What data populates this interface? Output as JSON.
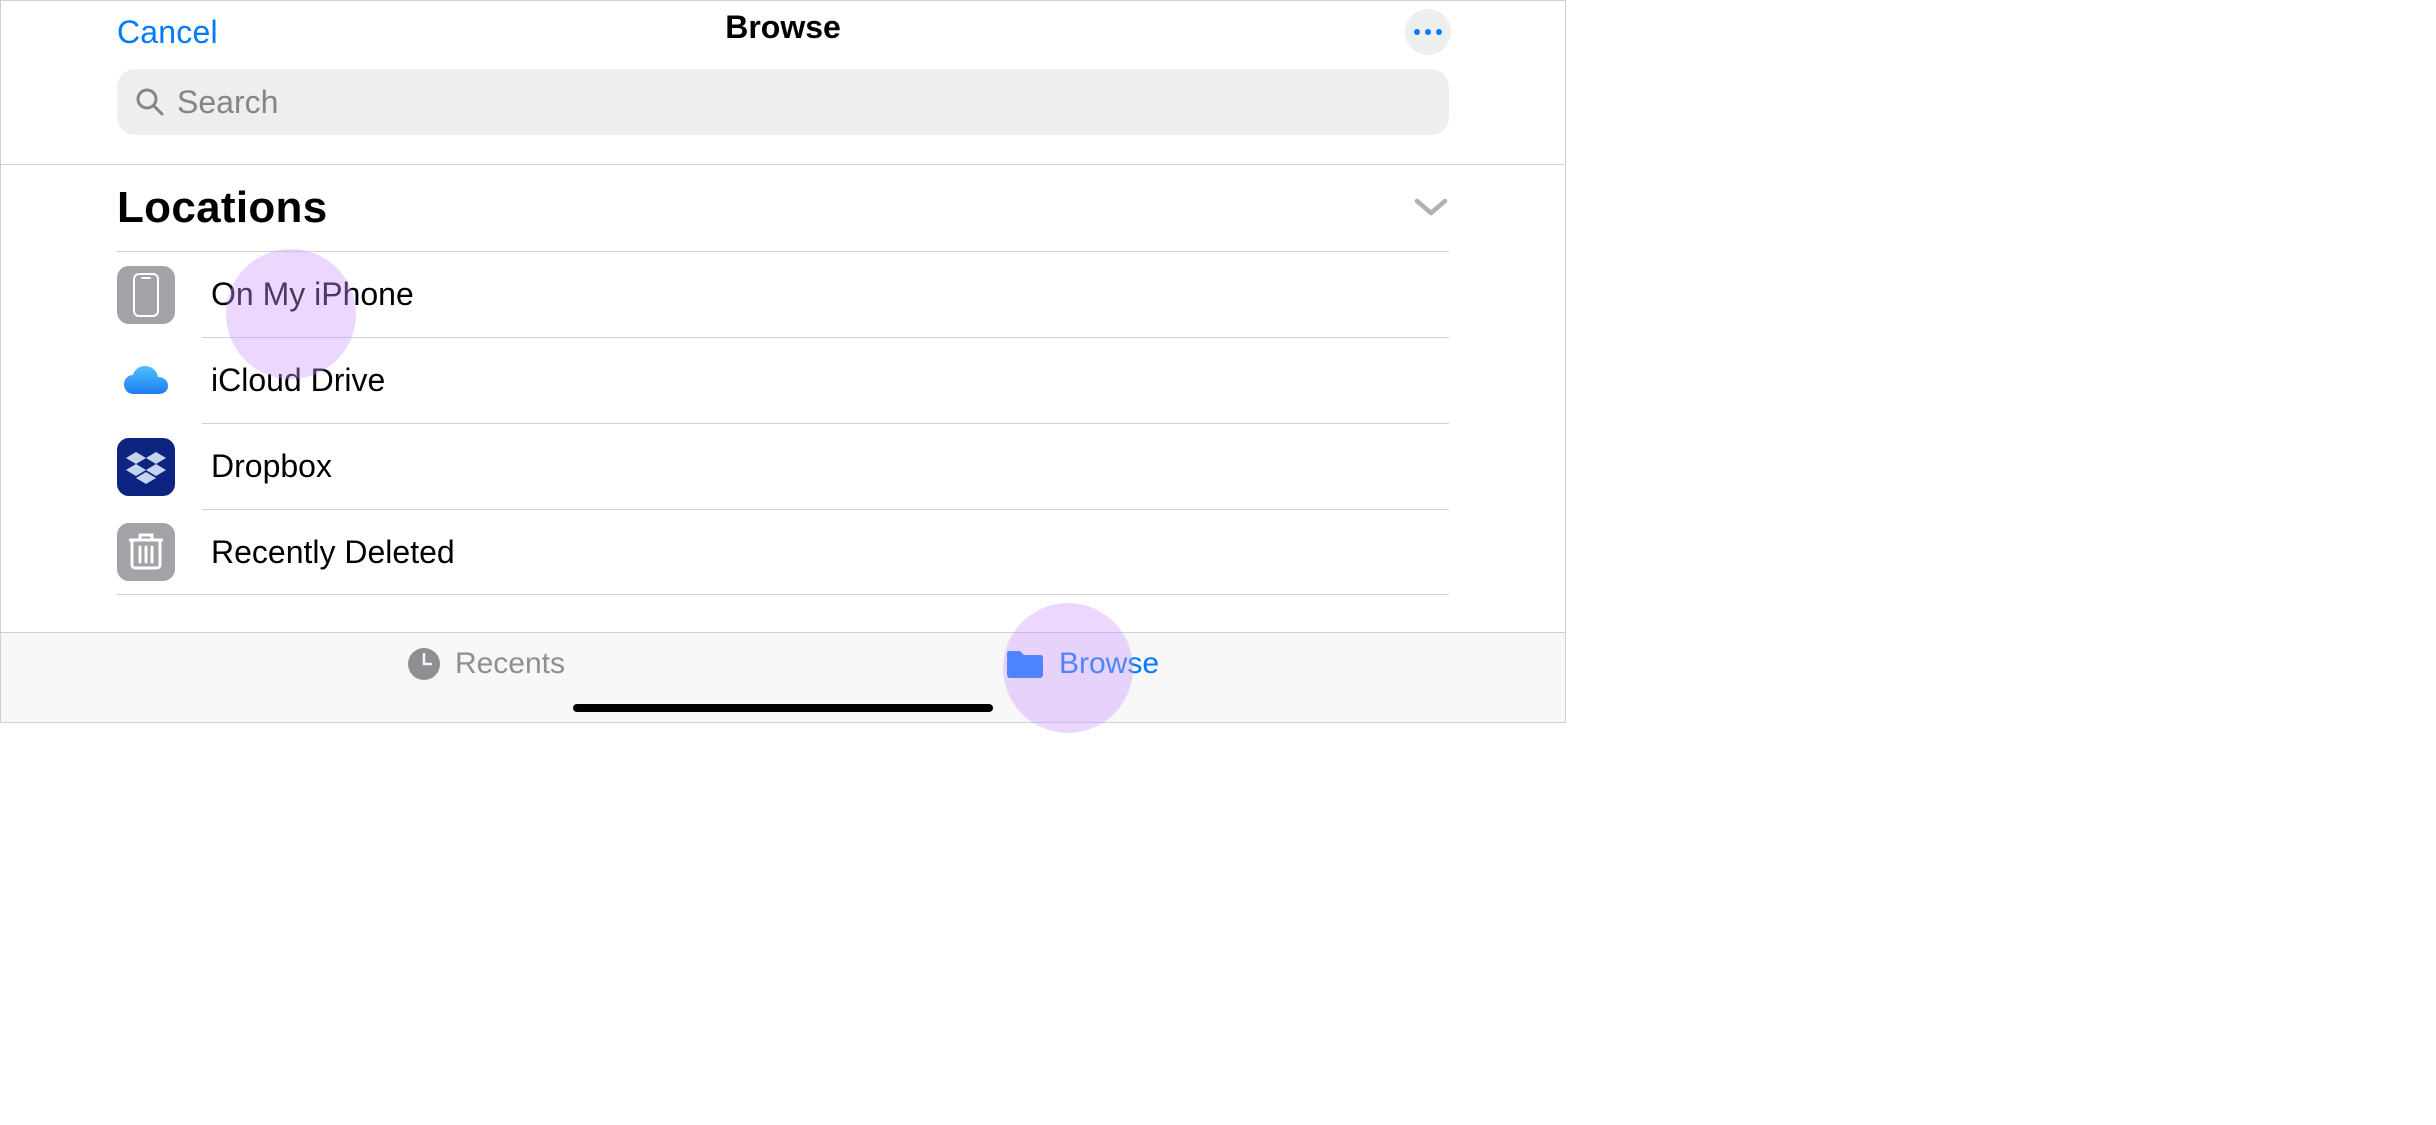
{
  "header": {
    "cancel_label": "Cancel",
    "title": "Browse"
  },
  "search": {
    "placeholder": "Search"
  },
  "section": {
    "title": "Locations",
    "items": [
      {
        "icon": "iphone-icon",
        "label": "On My iPhone"
      },
      {
        "icon": "icloud-icon",
        "label": "iCloud Drive"
      },
      {
        "icon": "dropbox-icon",
        "label": "Dropbox"
      },
      {
        "icon": "trash-icon",
        "label": "Recently Deleted"
      }
    ]
  },
  "toolbar": {
    "recents_label": "Recents",
    "browse_label": "Browse",
    "active_tab": "browse"
  },
  "colors": {
    "accent": "#007aff",
    "secondary_text": "#8e8e93",
    "search_bg": "#eeeeef"
  }
}
